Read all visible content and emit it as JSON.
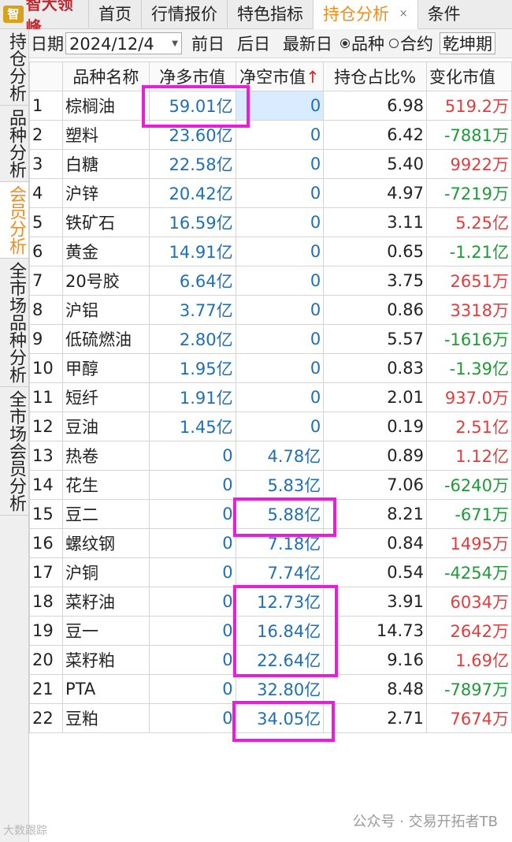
{
  "app": {
    "logo_text": "智大领峰",
    "tabs": [
      {
        "label": "首页"
      },
      {
        "label": "行情报价"
      },
      {
        "label": "特色指标"
      },
      {
        "label": "持仓分析"
      },
      {
        "label": "条件"
      }
    ],
    "active_tab_close": "×"
  },
  "sidebar": {
    "tabs": [
      "持仓分析",
      "品种分析",
      "会员分析",
      "全市场品种分析",
      "全市场会员分析"
    ],
    "active": "会员分析"
  },
  "toolbar": {
    "date_label": "日期",
    "date_value": "2024/12/4",
    "prev_day": "前日",
    "next_day": "后日",
    "latest_day": "最新日",
    "radio_variety": "品种",
    "radio_contract": "合约",
    "selected_radio": "品种",
    "member_value": "乾坤期"
  },
  "table": {
    "headers": {
      "name": "品种名称",
      "net_long": "净多市值",
      "net_short": "净空市值",
      "sort_arrow": "↑",
      "ratio": "持仓占比%",
      "change": "变化市值"
    },
    "rows": [
      {
        "idx": "1",
        "name": "棕榈油",
        "long": "59.01亿",
        "short": "0",
        "ratio": "6.98",
        "change": "519.2万",
        "dir": "up"
      },
      {
        "idx": "2",
        "name": "塑料",
        "long": "23.60亿",
        "short": "0",
        "ratio": "6.42",
        "change": "-7881万",
        "dir": "down"
      },
      {
        "idx": "3",
        "name": "白糖",
        "long": "22.58亿",
        "short": "0",
        "ratio": "5.40",
        "change": "9922万",
        "dir": "up"
      },
      {
        "idx": "4",
        "name": "沪锌",
        "long": "20.42亿",
        "short": "0",
        "ratio": "4.97",
        "change": "-7219万",
        "dir": "down"
      },
      {
        "idx": "5",
        "name": "铁矿石",
        "long": "16.59亿",
        "short": "0",
        "ratio": "3.11",
        "change": "5.25亿",
        "dir": "up"
      },
      {
        "idx": "6",
        "name": "黄金",
        "long": "14.91亿",
        "short": "0",
        "ratio": "0.65",
        "change": "-1.21亿",
        "dir": "down"
      },
      {
        "idx": "7",
        "name": "20号胶",
        "long": "6.64亿",
        "short": "0",
        "ratio": "3.75",
        "change": "2651万",
        "dir": "up"
      },
      {
        "idx": "8",
        "name": "沪铝",
        "long": "3.77亿",
        "short": "0",
        "ratio": "0.86",
        "change": "3318万",
        "dir": "up"
      },
      {
        "idx": "9",
        "name": "低硫燃油",
        "long": "2.80亿",
        "short": "0",
        "ratio": "5.57",
        "change": "-1616万",
        "dir": "down"
      },
      {
        "idx": "10",
        "name": "甲醇",
        "long": "1.95亿",
        "short": "0",
        "ratio": "0.83",
        "change": "-1.39亿",
        "dir": "down"
      },
      {
        "idx": "11",
        "name": "短纤",
        "long": "1.91亿",
        "short": "0",
        "ratio": "2.01",
        "change": "937.0万",
        "dir": "up"
      },
      {
        "idx": "12",
        "name": "豆油",
        "long": "1.45亿",
        "short": "0",
        "ratio": "0.19",
        "change": "2.51亿",
        "dir": "up"
      },
      {
        "idx": "13",
        "name": "热卷",
        "long": "0",
        "short": "4.78亿",
        "ratio": "0.89",
        "change": "1.12亿",
        "dir": "up"
      },
      {
        "idx": "14",
        "name": "花生",
        "long": "0",
        "short": "5.83亿",
        "ratio": "7.06",
        "change": "-6240万",
        "dir": "down"
      },
      {
        "idx": "15",
        "name": "豆二",
        "long": "0",
        "short": "5.88亿",
        "ratio": "8.21",
        "change": "-671万",
        "dir": "down"
      },
      {
        "idx": "16",
        "name": "螺纹钢",
        "long": "0",
        "short": "7.18亿",
        "ratio": "0.84",
        "change": "1495万",
        "dir": "up"
      },
      {
        "idx": "17",
        "name": "沪铜",
        "long": "0",
        "short": "7.74亿",
        "ratio": "0.54",
        "change": "-4254万",
        "dir": "down"
      },
      {
        "idx": "18",
        "name": "菜籽油",
        "long": "0",
        "short": "12.73亿",
        "ratio": "3.91",
        "change": "6034万",
        "dir": "up"
      },
      {
        "idx": "19",
        "name": "豆一",
        "long": "0",
        "short": "16.84亿",
        "ratio": "14.73",
        "change": "2642万",
        "dir": "up"
      },
      {
        "idx": "20",
        "name": "菜籽粕",
        "long": "0",
        "short": "22.64亿",
        "ratio": "9.16",
        "change": "1.69亿",
        "dir": "up"
      },
      {
        "idx": "21",
        "name": "PTA",
        "long": "0",
        "short": "32.80亿",
        "ratio": "8.48",
        "change": "-7897万",
        "dir": "down"
      },
      {
        "idx": "22",
        "name": "豆粕",
        "long": "0",
        "short": "34.05亿",
        "ratio": "2.71",
        "change": "7674万",
        "dir": "up"
      }
    ]
  },
  "colors": {
    "accent_orange": "#f08c1d",
    "positive_red": "#e23c3c",
    "negative_green": "#1e9a36",
    "value_blue": "#1e6fb5",
    "highlight_magenta": "#e81ed8"
  },
  "watermark": {
    "text": "公众号 · 交易开拓者TB",
    "left_text": "大数跟踪"
  }
}
